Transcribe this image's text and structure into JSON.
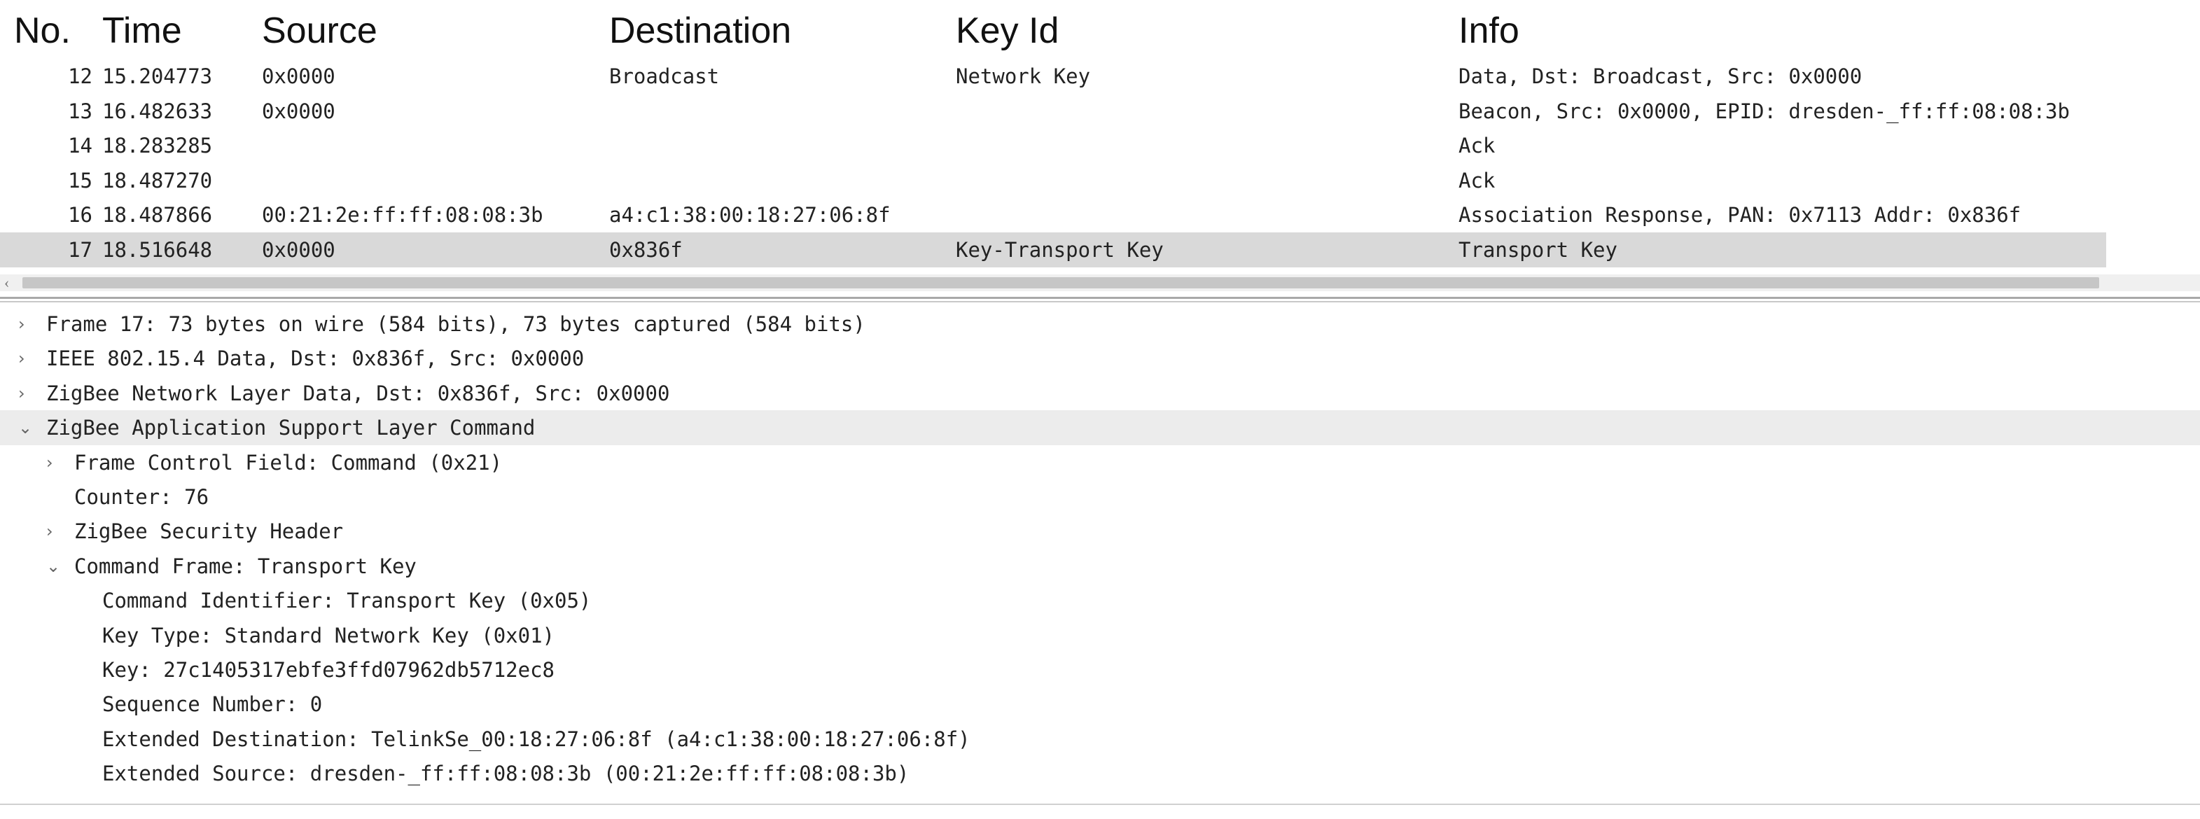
{
  "packet_list": {
    "columns": {
      "no": "No.",
      "time": "Time",
      "source": "Source",
      "destination": "Destination",
      "key_id": "Key Id",
      "info": "Info"
    },
    "rows": [
      {
        "no": "12",
        "time": "15.204773",
        "source": "0x0000",
        "destination": "Broadcast",
        "key_id": "Network Key",
        "info": "Data, Dst: Broadcast, Src: 0x0000"
      },
      {
        "no": "13",
        "time": "16.482633",
        "source": "0x0000",
        "destination": "",
        "key_id": "",
        "info": "Beacon, Src: 0x0000, EPID: dresden-_ff:ff:08:08:3b"
      },
      {
        "no": "14",
        "time": "18.283285",
        "source": "",
        "destination": "",
        "key_id": "",
        "info": "Ack"
      },
      {
        "no": "15",
        "time": "18.487270",
        "source": "",
        "destination": "",
        "key_id": "",
        "info": "Ack"
      },
      {
        "no": "16",
        "time": "18.487866",
        "source": "00:21:2e:ff:ff:08:08:3b",
        "destination": "a4:c1:38:00:18:27:06:8f",
        "key_id": "",
        "info": "Association Response, PAN: 0x7113 Addr: 0x836f"
      },
      {
        "no": "17",
        "time": "18.516648",
        "source": "0x0000",
        "destination": "0x836f",
        "key_id": "Key-Transport Key",
        "info": "Transport Key"
      }
    ],
    "selected_no": "17"
  },
  "detail_tree": {
    "nodes": [
      {
        "text": "Frame 17: 73 bytes on wire (584 bits), 73 bytes captured (584 bits)",
        "expander": "›",
        "level": 0
      },
      {
        "text": "IEEE 802.15.4 Data, Dst: 0x836f, Src: 0x0000",
        "expander": "›",
        "level": 0
      },
      {
        "text": "ZigBee Network Layer Data, Dst: 0x836f, Src: 0x0000",
        "expander": "›",
        "level": 0
      },
      {
        "text": "ZigBee Application Support Layer Command",
        "expander": "⌄",
        "level": 0
      },
      {
        "text": "Frame Control Field: Command (0x21)",
        "expander": "›",
        "level": 1
      },
      {
        "text": "Counter: 76",
        "expander": "",
        "level": 1
      },
      {
        "text": "ZigBee Security Header",
        "expander": "›",
        "level": 1
      },
      {
        "text": "Command Frame: Transport Key",
        "expander": "⌄",
        "level": 1
      },
      {
        "text": "Command Identifier: Transport Key (0x05)",
        "expander": "",
        "level": 2
      },
      {
        "text": "Key Type: Standard Network Key (0x01)",
        "expander": "",
        "level": 2
      },
      {
        "text": "Key: 27c1405317ebfe3ffd07962db5712ec8",
        "expander": "",
        "level": 2
      },
      {
        "text": "Sequence Number: 0",
        "expander": "",
        "level": 2
      },
      {
        "text": "Extended Destination: TelinkSe_00:18:27:06:8f (a4:c1:38:00:18:27:06:8f)",
        "expander": "",
        "level": 2
      },
      {
        "text": "Extended Source: dresden-_ff:ff:08:08:3b (00:21:2e:ff:ff:08:08:3b)",
        "expander": "",
        "level": 2
      }
    ],
    "highlighted_index": 3
  },
  "scrollbar": {
    "left_arrow_icon": "‹"
  },
  "icons": {
    "collapsed": "chevron-right-icon",
    "expanded": "chevron-down-icon"
  },
  "colors": {
    "selected_row": "#d9d9d9",
    "highlight_row": "#ececec"
  }
}
